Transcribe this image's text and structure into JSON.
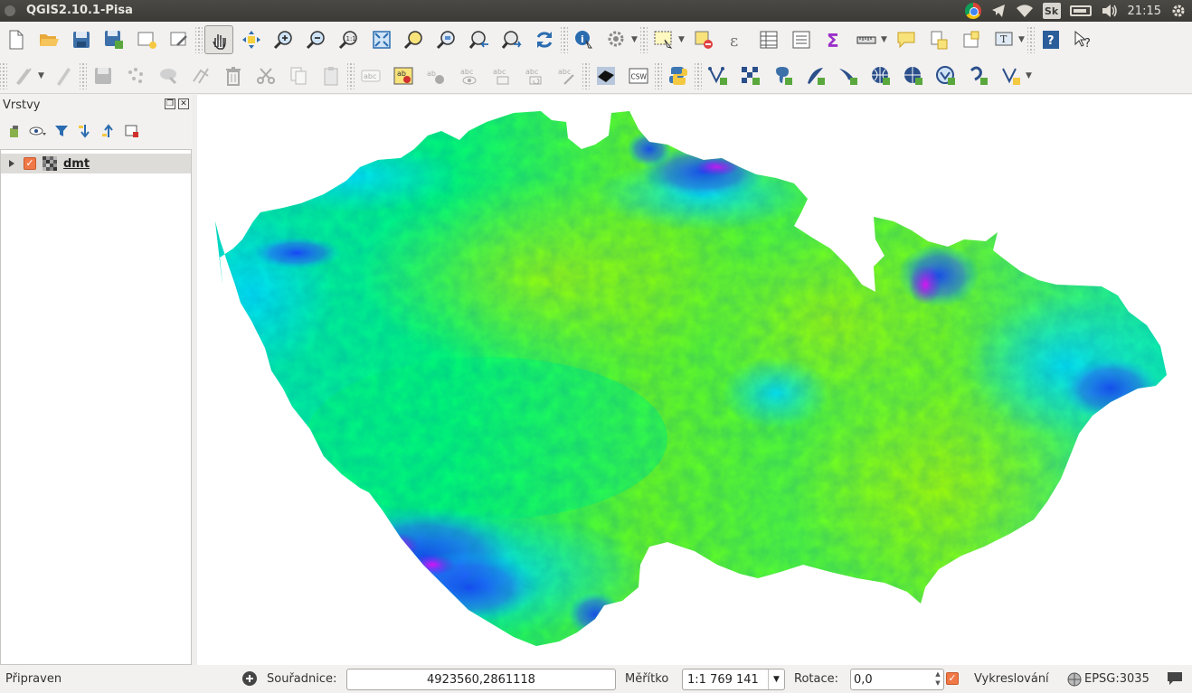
{
  "window": {
    "title": "QGIS2.10.1-Pisa"
  },
  "tray": {
    "keyboard": "Sk",
    "clock": "21:15"
  },
  "layers_panel": {
    "title": "Vrstvy",
    "layers": [
      {
        "name": "dmt",
        "checked": true
      }
    ]
  },
  "status": {
    "ready_text": "Připraven",
    "coord_label": "Souřadnice:",
    "coord_value": "4923560,2861118",
    "scale_label": "Měřítko",
    "scale_value": "1:1 769 141",
    "rotation_label": "Rotace:",
    "rotation_value": "0,0",
    "render_label": "Vykreslování",
    "render_checked": true,
    "crs": "EPSG:3035"
  },
  "toolbar_icons": {
    "row1": [
      "new-project-icon",
      "open-project-icon",
      "save-project-icon",
      "save-as-icon",
      "new-print-composer-icon",
      "composer-manager-icon",
      "pan-map-icon",
      "pan-to-selection-icon",
      "zoom-in-icon",
      "zoom-out-icon",
      "zoom-actual-size-icon",
      "zoom-full-icon",
      "zoom-to-selection-icon",
      "zoom-to-layer-icon",
      "zoom-last-icon",
      "zoom-next-icon",
      "refresh-icon",
      "identify-icon",
      "run-action-icon",
      "select-features-icon",
      "deselect-all-icon",
      "field-calculator-icon",
      "attribute-table-icon",
      "statistics-icon",
      "sum-icon",
      "measure-icon",
      "map-tips-icon",
      "new-bookmark-icon",
      "show-bookmarks-icon",
      "text-annotation-icon",
      "help-contents-icon",
      "whats-this-icon"
    ],
    "row2": [
      "current-edits-icon",
      "toggle-editing-icon",
      "save-layer-edits-icon",
      "add-feature-icon",
      "move-feature-icon",
      "node-tool-icon",
      "delete-selected-icon",
      "cut-features-icon",
      "copy-features-icon",
      "paste-features-icon",
      "label-icon",
      "layer-labeling-icon",
      "pin-labels-icon",
      "show-hide-labels-icon",
      "move-label-icon",
      "rotate-label-icon",
      "change-label-icon",
      "grass-icon",
      "csw-icon",
      "python-console-icon",
      "new-shapefile-icon",
      "add-raster-icon",
      "add-postgis-icon",
      "add-spatialite-icon",
      "add-mssql-icon",
      "add-wms-icon",
      "add-wcs-icon",
      "add-wfs-icon",
      "add-delimited-text-icon",
      "add-virtual-layer-icon"
    ]
  },
  "colors": {
    "map_low": "#a8ff00",
    "map_mid": "#00ff66",
    "map_high": "#00e5ff",
    "map_peak": "#ff00ff",
    "checkbox": "#f07746"
  }
}
